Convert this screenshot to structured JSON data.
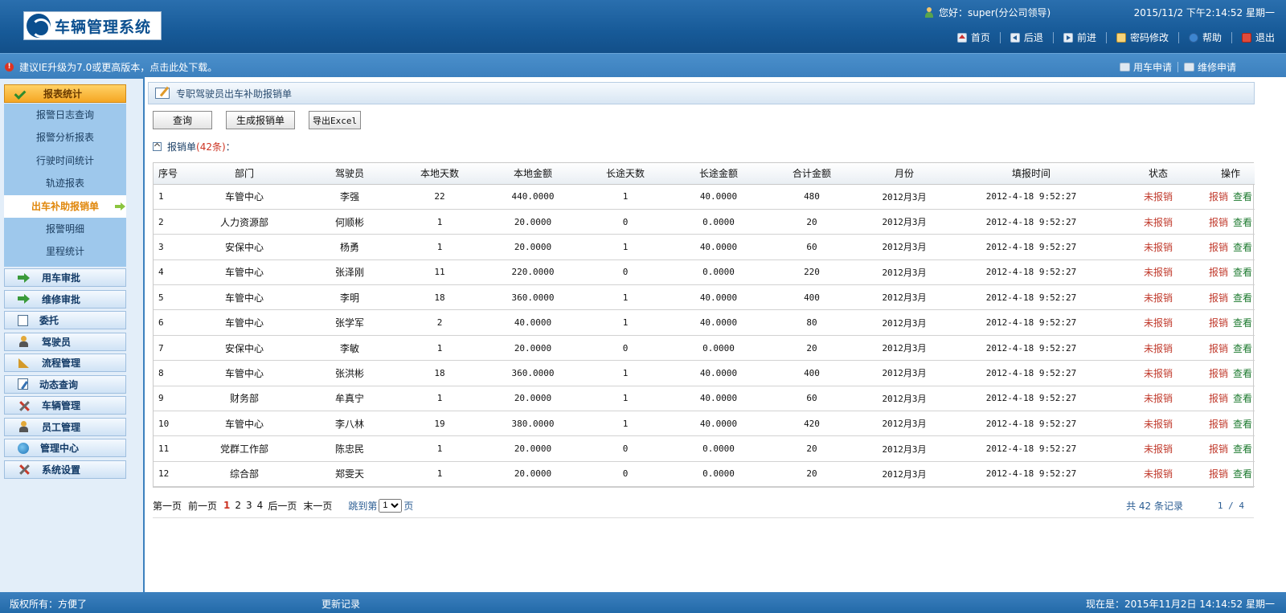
{
  "app": {
    "logo_text": "车辆管理系统",
    "greeting": "您好：super(分公司领导)",
    "datetime": "2015/11/2 下午2:14:52 星期一"
  },
  "topnav": {
    "home": "首页",
    "back": "后退",
    "forward": "前进",
    "password": "密码修改",
    "help": "帮助",
    "logout": "退出"
  },
  "notice": {
    "text": "建议IE升级为7.0或更高版本，点击此处下载。",
    "apply_vehicle": "用车申请",
    "apply_repair": "维修申请"
  },
  "sidebar": {
    "section": "报表统计",
    "subitems": [
      "报警日志查询",
      "报警分析报表",
      "行驶时间统计",
      "轨迹报表",
      "出车补助报销单",
      "报警明细",
      "里程统计"
    ],
    "active_index": 4,
    "menu": [
      "用车审批",
      "维修审批",
      "委托",
      "驾驶员",
      "流程管理",
      "动态查询",
      "车辆管理",
      "员工管理",
      "管理中心",
      "系统设置"
    ]
  },
  "main": {
    "title": "专职驾驶员出车补助报销单",
    "buttons": {
      "query": "查询",
      "generate": "生成报销单",
      "export": "导出Excel"
    },
    "list_label": "报销单",
    "list_count": "(42条)",
    "list_colon": "："
  },
  "table": {
    "headers": [
      "序号",
      "部门",
      "驾驶员",
      "本地天数",
      "本地金额",
      "长途天数",
      "长途金额",
      "合计金额",
      "月份",
      "填报时间",
      "状态",
      "操作"
    ],
    "op_edit": "报销",
    "op_view": "查看",
    "rows": [
      [
        "1",
        "车管中心",
        "李强",
        "22",
        "440.0000",
        "1",
        "40.0000",
        "480",
        "2012月3月",
        "2012-4-18 9:52:27",
        "未报销"
      ],
      [
        "2",
        "人力资源部",
        "何顺彬",
        "1",
        "20.0000",
        "0",
        "0.0000",
        "20",
        "2012月3月",
        "2012-4-18 9:52:27",
        "未报销"
      ],
      [
        "3",
        "安保中心",
        "杨勇",
        "1",
        "20.0000",
        "1",
        "40.0000",
        "60",
        "2012月3月",
        "2012-4-18 9:52:27",
        "未报销"
      ],
      [
        "4",
        "车管中心",
        "张泽刚",
        "11",
        "220.0000",
        "0",
        "0.0000",
        "220",
        "2012月3月",
        "2012-4-18 9:52:27",
        "未报销"
      ],
      [
        "5",
        "车管中心",
        "李明",
        "18",
        "360.0000",
        "1",
        "40.0000",
        "400",
        "2012月3月",
        "2012-4-18 9:52:27",
        "未报销"
      ],
      [
        "6",
        "车管中心",
        "张学军",
        "2",
        "40.0000",
        "1",
        "40.0000",
        "80",
        "2012月3月",
        "2012-4-18 9:52:27",
        "未报销"
      ],
      [
        "7",
        "安保中心",
        "李敏",
        "1",
        "20.0000",
        "0",
        "0.0000",
        "20",
        "2012月3月",
        "2012-4-18 9:52:27",
        "未报销"
      ],
      [
        "8",
        "车管中心",
        "张洪彬",
        "18",
        "360.0000",
        "1",
        "40.0000",
        "400",
        "2012月3月",
        "2012-4-18 9:52:27",
        "未报销"
      ],
      [
        "9",
        "财务部",
        "牟真宁",
        "1",
        "20.0000",
        "1",
        "40.0000",
        "60",
        "2012月3月",
        "2012-4-18 9:52:27",
        "未报销"
      ],
      [
        "10",
        "车管中心",
        "李八林",
        "19",
        "380.0000",
        "1",
        "40.0000",
        "420",
        "2012月3月",
        "2012-4-18 9:52:27",
        "未报销"
      ],
      [
        "11",
        "党群工作部",
        "陈忠民",
        "1",
        "20.0000",
        "0",
        "0.0000",
        "20",
        "2012月3月",
        "2012-4-18 9:52:27",
        "未报销"
      ],
      [
        "12",
        "综合部",
        "郑雯天",
        "1",
        "20.0000",
        "0",
        "0.0000",
        "20",
        "2012月3月",
        "2012-4-18 9:52:27",
        "未报销"
      ]
    ]
  },
  "pager": {
    "first": "第一页",
    "prev": "前一页",
    "pages": [
      "1",
      "2",
      "3",
      "4"
    ],
    "current": "1",
    "next": "后一页",
    "last": "末一页",
    "jump_prefix": "跳到第",
    "jump_value": "1",
    "jump_suffix": "页",
    "total": "共 42 条记录",
    "ratio": "1 / 4"
  },
  "footer": {
    "copyright": "版权所有：方便了",
    "changelog": "更新记录",
    "now": "现在是：2015年11月2日 14:14:52 星期一"
  },
  "colors": {
    "header_blue": "#175a98",
    "accent_orange": "#f5a623",
    "status_red": "#c0392b",
    "view_green": "#1d7a2f"
  }
}
